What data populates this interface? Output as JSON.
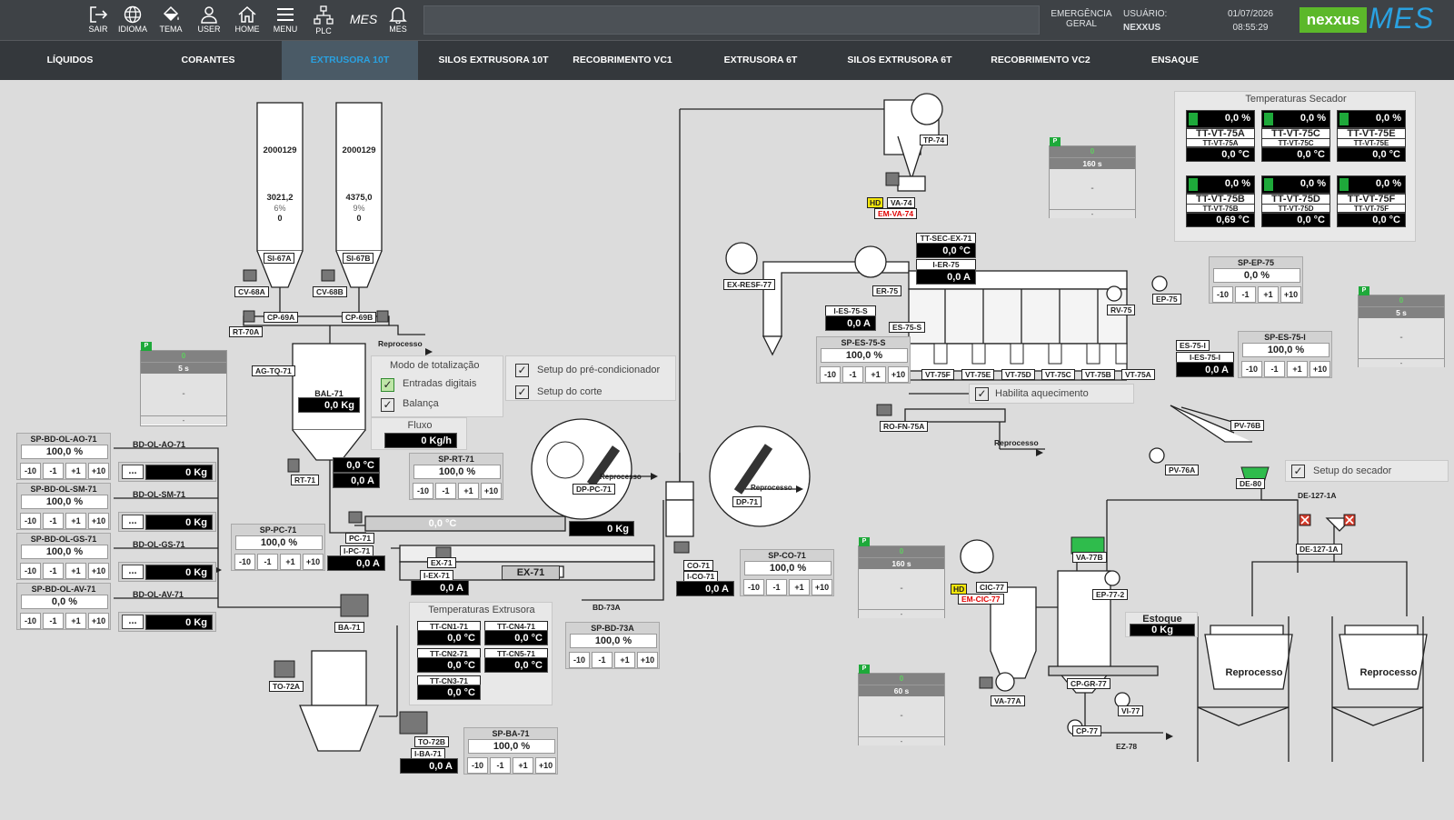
{
  "topbar": {
    "buttons": [
      {
        "label": "SAIR"
      },
      {
        "label": "IDIOMA"
      },
      {
        "label": "TEMA"
      },
      {
        "label": "USER"
      },
      {
        "label": "HOME"
      },
      {
        "label": "MENU"
      },
      {
        "label": "PLC"
      },
      {
        "label": "MES"
      }
    ],
    "mes_button_text": "MES",
    "emergency_line1": "EMERGÊNCIA",
    "emergency_line2": "GERAL",
    "user_label": "USUÁRIO:",
    "user_value": "NEXXUS",
    "date": "01/07/2026",
    "time": "08:55:29",
    "brand": "nexxus",
    "brand_product": "MES"
  },
  "nav": {
    "tabs": [
      "LÍQUIDOS",
      "CORANTES",
      "EXTRUSORA 10T",
      "SILOS EXTRUSORA 10T",
      "RECOBRIMENTO VC1",
      "EXTRUSORA 6T",
      "SILOS EXTRUSORA 6T",
      "RECOBRIMENTO VC2",
      "ENSAQUE"
    ],
    "active": "EXTRUSORA 10T"
  },
  "colors": {
    "accent": "#2aa1e0",
    "ok": "#1ea93a",
    "alarm_text": "#e00000",
    "hd": "#f4e60c",
    "brand_bg": "#5cb82a"
  },
  "silos": [
    {
      "code": "2000129",
      "value": "3021,2",
      "pct": "6%",
      "zero": "0",
      "label": "SI-67A"
    },
    {
      "code": "2000129",
      "value": "4375,0",
      "pct": "9%",
      "zero": "0",
      "label": "SI-67B"
    }
  ],
  "labels": {
    "cv68a": "CV-68A",
    "cv68b": "CV-68B",
    "cp69a": "CP-69A",
    "cp69b": "CP-69B",
    "rt70a": "RT-70A",
    "agtq71": "AG-TQ-71",
    "bal71": "BAL-71",
    "rt71": "RT-71",
    "pc71": "PC-71",
    "ipc71": "I-PC-71",
    "ba71": "BA-71",
    "to72a": "TO-72A",
    "to72b": "TO-72B",
    "iba71": "I-BA-71",
    "ex71": "EX-71",
    "iex71": "I-EX-71",
    "ex71main": "EX-71",
    "dppc71": "DP-PC-71",
    "dp71": "DP-71",
    "co71": "CO-71",
    "ico71": "I-CO-71",
    "bd73a": "BD-73A",
    "tp74": "TP-74",
    "va74": "VA-74",
    "emva74": "EM-VA-74",
    "exresf77": "EX-RESF-77",
    "er75": "ER-75",
    "ttsecex71": "TT-SEC-EX-71",
    "ier75": "I-ER-75",
    "ies75s": "I-ES-75-S",
    "es75s": "ES-75-S",
    "rv75": "RV-75",
    "ep75": "EP-75",
    "es75i": "ES-75-I",
    "ies75i": "I-ES-75-I",
    "rofn75a": "RO-FN-75A",
    "pv76b": "PV-76B",
    "pv76a": "PV-76A",
    "de80": "DE-80",
    "de127_1a": "DE-127-1A",
    "de127_1a_b": "DE-127-1A",
    "va77b": "VA-77B",
    "cic77": "CIC-77",
    "emcic77": "EM-CIC-77",
    "ep772": "EP-77-2",
    "va77a": "VA-77A",
    "cpgr77": "CP-GR-77",
    "vi77": "VI-77",
    "cp77": "CP-77",
    "ez78": "EZ-78",
    "hd": "HD",
    "bdolao71": "BD-OL-AO-71",
    "bdolsm71": "BD-OL-SM-71",
    "bdolgs71": "BD-OL-GS-71",
    "bdolav71": "BD-OL-AV-71",
    "vt": [
      "VT-75F",
      "VT-75E",
      "VT-75D",
      "VT-75C",
      "VT-75B",
      "VT-75A"
    ]
  },
  "arrows": {
    "reprocesso": "Reprocesso"
  },
  "readouts": {
    "bal71": "0,0 Kg",
    "rt71_temp": "0,0 °C",
    "rt71_amp": "0,0 A",
    "fluxo_label": "Fluxo",
    "fluxo": "0 Kg/h",
    "pc71_temp": "0,0 °C",
    "ipc71": "0,0 A",
    "ex_kg": "0 Kg",
    "iex71": "0,0 A",
    "ico71": "0,0 A",
    "iba71": "0,0 A",
    "ttsecex71": "0,0 °C",
    "ier75": "0,0 A",
    "ies75s": "0,0 A",
    "ies75i": "0,0 A",
    "estoque_label": "Estoque",
    "estoque": "0 Kg"
  },
  "bd_inputs": [
    {
      "sp": "SP-BD-OL-AO-71",
      "val": "100,0 %",
      "kg": "0 Kg"
    },
    {
      "sp": "SP-BD-OL-SM-71",
      "val": "100,0 %",
      "kg": "0 Kg"
    },
    {
      "sp": "SP-BD-OL-GS-71",
      "val": "100,0 %",
      "kg": "0 Kg"
    },
    {
      "sp": "SP-BD-OL-AV-71",
      "val": "0,0 %",
      "kg": "0 Kg"
    }
  ],
  "ellipsis": "...",
  "step_buttons": [
    "-10",
    "-1",
    "+1",
    "+10"
  ],
  "setpoints": {
    "sprt71": {
      "t": "SP-RT-71",
      "v": "100,0 %"
    },
    "sppc71": {
      "t": "SP-PC-71",
      "v": "100,0 %"
    },
    "spco71": {
      "t": "SP-CO-71",
      "v": "100,0 %"
    },
    "spbd73a": {
      "t": "SP-BD-73A",
      "v": "100,0 %"
    },
    "spba71": {
      "t": "SP-BA-71",
      "v": "100,0 %"
    },
    "spes75s": {
      "t": "SP-ES-75-S",
      "v": "100,0 %"
    },
    "spep75": {
      "t": "SP-EP-75",
      "v": "0,0 %"
    },
    "spes75i": {
      "t": "SP-ES-75-I",
      "v": "100,0 %"
    }
  },
  "totalizacao": {
    "title": "Modo de totalização",
    "opt1": "Entradas digitais",
    "opt2": "Balança"
  },
  "setup": {
    "precond": "Setup do pré-condicionador",
    "corte": "Setup do corte",
    "secador": "Setup do secador",
    "aquecimento": "Habilita aquecimento"
  },
  "temp_extrusora": {
    "title": "Temperaturas Extrusora",
    "items": [
      {
        "n": "TT-CN1-71",
        "v": "0,0 °C"
      },
      {
        "n": "TT-CN4-71",
        "v": "0,0 °C"
      },
      {
        "n": "TT-CN2-71",
        "v": "0,0 °C"
      },
      {
        "n": "TT-CN5-71",
        "v": "0,0 °C"
      },
      {
        "n": "TT-CN3-71",
        "v": "0,0 °C"
      }
    ]
  },
  "temp_secador": {
    "title": "Temperaturas Secador",
    "items": [
      {
        "pct": "0,0 %",
        "n": "TT-VT-75A",
        "n2": "TT-VT-75A",
        "v": "0,0 °C"
      },
      {
        "pct": "0,0 %",
        "n": "TT-VT-75C",
        "n2": "TT-VT-75C",
        "v": "0,0 °C"
      },
      {
        "pct": "0,0 %",
        "n": "TT-VT-75E",
        "n2": "TT-VT-75E",
        "v": "0,0 °C"
      },
      {
        "pct": "0,0 %",
        "n": "TT-VT-75B",
        "n2": "TT-VT-75B",
        "v": "0,69 °C"
      },
      {
        "pct": "0,0 %",
        "n": "TT-VT-75D",
        "n2": "TT-VT-75D",
        "v": "0,0 °C"
      },
      {
        "pct": "0,0 %",
        "n": "TT-VT-75F",
        "n2": "TT-VT-75F",
        "v": "0,0 °C"
      }
    ]
  },
  "timers": [
    {
      "p": "P",
      "count": "0",
      "t": "5 s",
      "body": "-",
      "foot": "-"
    },
    {
      "p": "P",
      "count": "0",
      "t": "160 s",
      "body": "-",
      "foot": "-"
    },
    {
      "p": "P",
      "count": "0",
      "t": "5 s",
      "body": "-",
      "foot": "-"
    },
    {
      "p": "P",
      "count": "0",
      "t": "160 s",
      "body": "-",
      "foot": "-"
    },
    {
      "p": "P",
      "count": "0",
      "t": "60 s",
      "body": "-",
      "foot": "-"
    }
  ],
  "tanks": [
    {
      "label": "Reprocesso"
    },
    {
      "label": "Reprocesso"
    }
  ]
}
